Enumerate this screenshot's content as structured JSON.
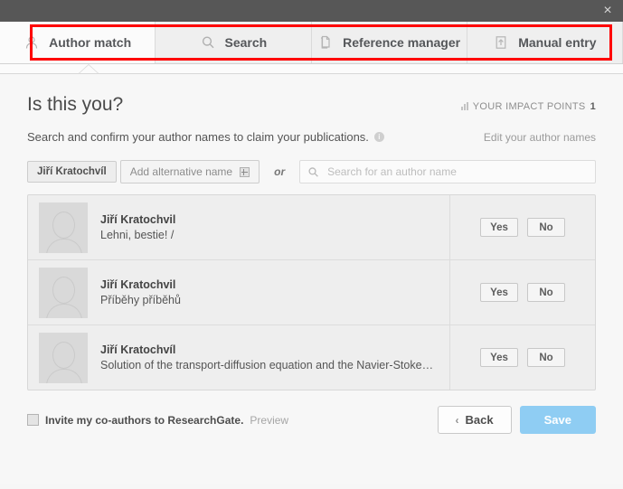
{
  "window": {
    "close_label": "×"
  },
  "tabs": [
    {
      "label": "Author match",
      "icon": "person-icon",
      "active": true
    },
    {
      "label": "Search",
      "icon": "search-icon",
      "active": false
    },
    {
      "label": "Reference manager",
      "icon": "document-icon",
      "active": false
    },
    {
      "label": "Manual entry",
      "icon": "upload-document-icon",
      "active": false
    }
  ],
  "main": {
    "title": "Is this you?",
    "subtitle": "Search and confirm your author names to claim your publications.",
    "info_icon_label": "i",
    "edit_link": "Edit your author names",
    "impact": {
      "label": "YOUR IMPACT POINTS",
      "value": "1"
    }
  },
  "name_row": {
    "chip": "Jiří Kratochvíl",
    "add_label": "Add alternative name",
    "or": "or",
    "search_placeholder": "Search for an author name",
    "search_value": ""
  },
  "results": {
    "yes_label": "Yes",
    "no_label": "No",
    "rows": [
      {
        "name": "Jiří Kratochvil",
        "publication": "Lehni, bestie! /"
      },
      {
        "name": "Jiří Kratochvil",
        "publication": "Příběhy příběhů"
      },
      {
        "name": "Jiří Kratochvíl",
        "publication": "Solution of the transport-diffusion equation and the Navier-Stokes equatio..."
      }
    ]
  },
  "footer": {
    "invite_label": "Invite my co-authors to ResearchGate.",
    "preview_label": "Preview",
    "back_label": "Back",
    "back_chevron": "‹",
    "save_label": "Save"
  },
  "colors": {
    "highlight": "#fe0000",
    "save_button": "#8fcdf3",
    "topbar": "#575757"
  }
}
